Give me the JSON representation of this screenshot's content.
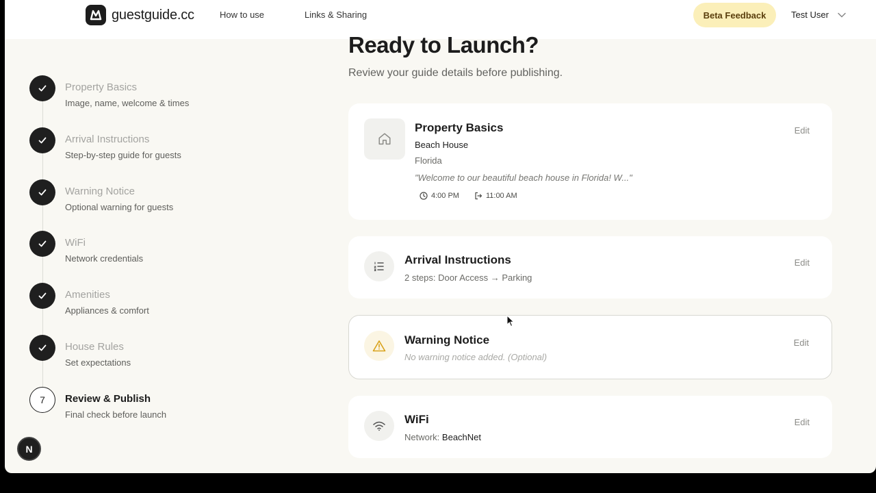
{
  "header": {
    "logo_text": "guestguide.cc",
    "nav": [
      "How to use",
      "Links & Sharing"
    ],
    "beta_button": "Beta Feedback",
    "user_name": "Test User"
  },
  "page": {
    "title": "Ready to Launch?",
    "subtitle": "Review your guide details before publishing."
  },
  "steps": [
    {
      "title": "Property Basics",
      "sub": "Image, name, welcome & times",
      "done": true
    },
    {
      "title": "Arrival Instructions",
      "sub": "Step-by-step guide for guests",
      "done": true
    },
    {
      "title": "Warning Notice",
      "sub": "Optional warning for guests",
      "done": true
    },
    {
      "title": "WiFi",
      "sub": "Network credentials",
      "done": true
    },
    {
      "title": "Amenities",
      "sub": "Appliances & comfort",
      "done": true
    },
    {
      "title": "House Rules",
      "sub": "Set expectations",
      "done": true
    },
    {
      "title": "Review & Publish",
      "sub": "Final check before launch",
      "done": false,
      "number": "7"
    }
  ],
  "cards": {
    "edit_label": "Edit",
    "property": {
      "title": "Property Basics",
      "name": "Beach House",
      "location": "Florida",
      "welcome": "\"Welcome to our beautiful beach house in Florida! W...\"",
      "checkin": "4:00 PM",
      "checkout": "11:00 AM"
    },
    "arrival": {
      "title": "Arrival Instructions",
      "summary": "2 steps: Door Access → Parking"
    },
    "warning": {
      "title": "Warning Notice",
      "summary": "No warning notice added. (Optional)"
    },
    "wifi": {
      "title": "WiFi",
      "network_label": "Network:",
      "network_name": "BeachNet"
    }
  },
  "badge": {
    "letter": "N"
  },
  "colors": {
    "accent": "#fbefb9",
    "dark": "#1f1f1f",
    "warning_icon": "#d9a21b"
  }
}
